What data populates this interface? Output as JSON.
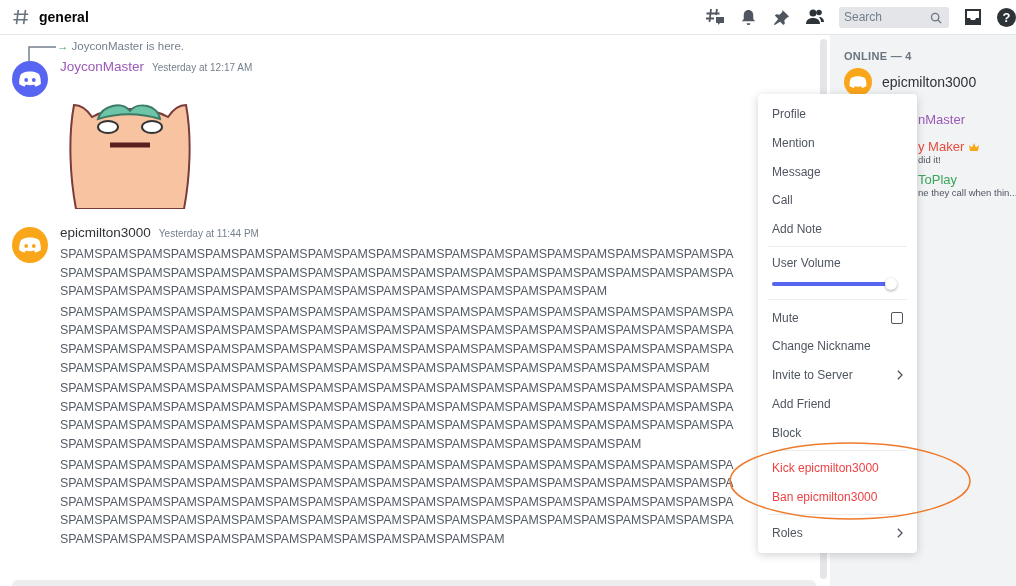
{
  "header": {
    "channel": "general",
    "search": {
      "placeholder": "Search"
    },
    "help": "?"
  },
  "messages": [
    {
      "kind": "join",
      "arrow": "→",
      "text": "JoyconMaster is here."
    },
    {
      "kind": "sticker",
      "author": {
        "name": "JoyconMaster",
        "color": "#9b59b6"
      },
      "avatar": {
        "color": "#5865f2"
      },
      "time": "Yesterday at 12:17 AM"
    },
    {
      "kind": "text",
      "author": {
        "name": "epicmilton3000",
        "color": "#2e3338"
      },
      "avatar": {
        "color": "#faa61a"
      },
      "time": "Yesterday at 11:44 PM",
      "groups": [
        [
          "SPAMSPAMSPAMSPAMSPAMSPAMSPAMSPAMSPAMSPAMSPAMSPAMSPAMSPAMSPAMSPAMSPAMSPAMSPAMSPA",
          "SPAMSPAMSPAMSPAMSPAMSPAMSPAMSPAMSPAMSPAMSPAMSPAMSPAMSPAMSPAMSPAMSPAMSPAMSPAMSPA",
          "SPAMSPAMSPAMSPAMSPAMSPAMSPAMSPAMSPAMSPAMSPAMSPAMSPAMSPAMSPAMSPAM"
        ],
        [
          "SPAMSPAMSPAMSPAMSPAMSPAMSPAMSPAMSPAMSPAMSPAMSPAMSPAMSPAMSPAMSPAMSPAMSPAMSPAMSPA",
          "SPAMSPAMSPAMSPAMSPAMSPAMSPAMSPAMSPAMSPAMSPAMSPAMSPAMSPAMSPAMSPAMSPAMSPAMSPAMSPA",
          "SPAMSPAMSPAMSPAMSPAMSPAMSPAMSPAMSPAMSPAMSPAMSPAMSPAMSPAMSPAMSPAMSPAMSPAMSPAMSPA",
          "SPAMSPAMSPAMSPAMSPAMSPAMSPAMSPAMSPAMSPAMSPAMSPAMSPAMSPAMSPAMSPAMSPAMSPAMSPAM"
        ],
        [
          "SPAMSPAMSPAMSPAMSPAMSPAMSPAMSPAMSPAMSPAMSPAMSPAMSPAMSPAMSPAMSPAMSPAMSPAMSPAMSPA",
          "SPAMSPAMSPAMSPAMSPAMSPAMSPAMSPAMSPAMSPAMSPAMSPAMSPAMSPAMSPAMSPAMSPAMSPAMSPAMSPA",
          "SPAMSPAMSPAMSPAMSPAMSPAMSPAMSPAMSPAMSPAMSPAMSPAMSPAMSPAMSPAMSPAMSPAMSPAMSPAMSPA",
          "SPAMSPAMSPAMSPAMSPAMSPAMSPAMSPAMSPAMSPAMSPAMSPAMSPAMSPAMSPAMSPAMSPAM"
        ],
        [
          "SPAMSPAMSPAMSPAMSPAMSPAMSPAMSPAMSPAMSPAMSPAMSPAMSPAMSPAMSPAMSPAMSPAMSPAMSPAMSPA",
          "SPAMSPAMSPAMSPAMSPAMSPAMSPAMSPAMSPAMSPAMSPAMSPAMSPAMSPAMSPAMSPAMSPAMSPAMSPAMSPA",
          "SPAMSPAMSPAMSPAMSPAMSPAMSPAMSPAMSPAMSPAMSPAMSPAMSPAMSPAMSPAMSPAMSPAMSPAMSPAMSPA",
          "SPAMSPAMSPAMSPAMSPAMSPAMSPAMSPAMSPAMSPAMSPAMSPAMSPAMSPAMSPAMSPAMSPAMSPAMSPAMSPA",
          "SPAMSPAMSPAMSPAMSPAMSPAMSPAMSPAMSPAMSPAMSPAMSPAMSPAM"
        ]
      ]
    }
  ],
  "members": {
    "heading": "ONLINE — 4",
    "items": [
      {
        "kind": "full",
        "name": "epicmilton3000",
        "color": "#2e3338",
        "avatar": {
          "color": "#faa61a"
        }
      },
      {
        "kind": "covered",
        "name": "nMaster",
        "color": "#9b59b6"
      },
      {
        "kind": "covered",
        "name": "y Maker",
        "color": "#e74c3c",
        "owner": true,
        "status": "did it!"
      },
      {
        "kind": "covered",
        "name": "ToPlay",
        "color": "#3ba55c",
        "owner": false,
        "status": "ne they call when thin..."
      }
    ]
  },
  "context_menu": {
    "sections": [
      [
        {
          "kind": "item",
          "label": "Profile"
        },
        {
          "kind": "item",
          "label": "Mention"
        },
        {
          "kind": "item",
          "label": "Message"
        },
        {
          "kind": "item",
          "label": "Call"
        },
        {
          "kind": "item",
          "label": "Add Note"
        }
      ],
      [
        {
          "kind": "slider",
          "label": "User Volume",
          "level": 0.97
        }
      ],
      [
        {
          "kind": "checkbox",
          "label": "Mute",
          "checked": false
        },
        {
          "kind": "item",
          "label": "Change Nickname"
        },
        {
          "kind": "submenu",
          "label": "Invite to Server"
        },
        {
          "kind": "item",
          "label": "Add Friend"
        },
        {
          "kind": "item",
          "label": "Block"
        }
      ],
      [
        {
          "kind": "danger",
          "label": "Kick epicmilton3000"
        },
        {
          "kind": "danger",
          "label": "Ban epicmilton3000"
        }
      ],
      [
        {
          "kind": "submenu",
          "label": "Roles"
        }
      ]
    ]
  }
}
